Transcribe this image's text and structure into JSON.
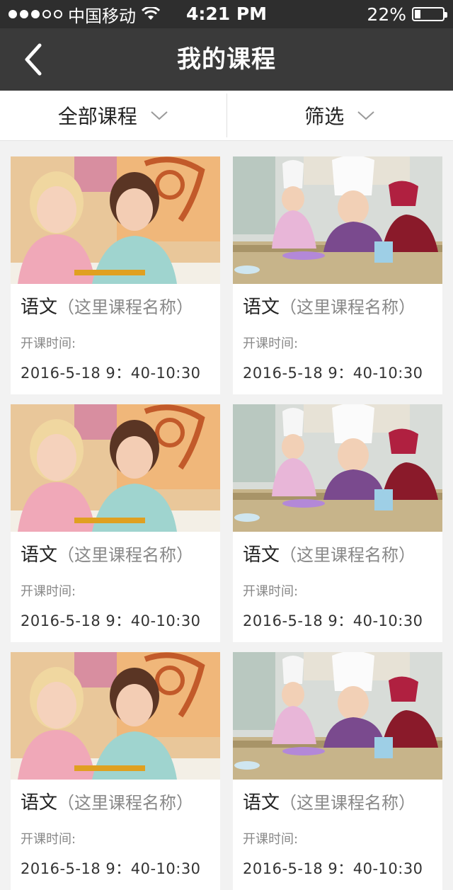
{
  "status_bar": {
    "carrier": "中国移动",
    "time": "4:21 PM",
    "battery": "22%",
    "battery_level": 0.22,
    "signal_bars_filled": 3,
    "signal_bars_total": 5
  },
  "nav": {
    "title": "我的课程",
    "back_icon": "chevron-left-icon"
  },
  "filters": {
    "all_courses": "全部课程",
    "filter": "筛选",
    "dropdown_icon": "chevron-down-icon"
  },
  "courses": [
    {
      "subject": "语文",
      "name": "（这里课程名称）",
      "time_label": "开课时间:",
      "time": "2016-5-18  9：40-10:30",
      "image": "girls-drawing-photo"
    },
    {
      "subject": "语文",
      "name": "（这里课程名称）",
      "time_label": "开课时间:",
      "time": "2016-5-18  9：40-10:30",
      "image": "kids-chef-hats-photo"
    },
    {
      "subject": "语文",
      "name": "（这里课程名称）",
      "time_label": "开课时间:",
      "time": "2016-5-18  9：40-10:30",
      "image": "girls-drawing-photo"
    },
    {
      "subject": "语文",
      "name": "（这里课程名称）",
      "time_label": "开课时间:",
      "time": "2016-5-18  9：40-10:30",
      "image": "kids-chef-hats-photo"
    },
    {
      "subject": "语文",
      "name": "（这里课程名称）",
      "time_label": "开课时间:",
      "time": "2016-5-18  9：40-10:30",
      "image": "girls-drawing-photo"
    },
    {
      "subject": "语文",
      "name": "（这里课程名称）",
      "time_label": "开课时间:",
      "time": "2016-5-18  9：40-10:30",
      "image": "kids-chef-hats-photo"
    }
  ]
}
